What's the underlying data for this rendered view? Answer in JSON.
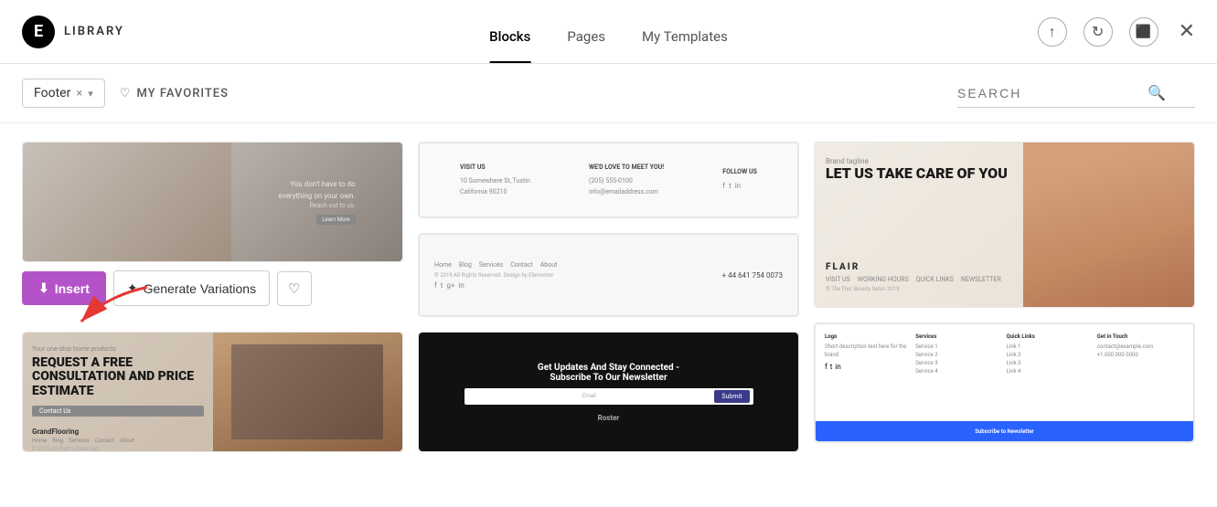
{
  "header": {
    "logo_letter": "E",
    "library_label": "LIBRARY",
    "tabs": [
      {
        "id": "blocks",
        "label": "Blocks",
        "active": true
      },
      {
        "id": "pages",
        "label": "Pages",
        "active": false
      },
      {
        "id": "my-templates",
        "label": "My Templates",
        "active": false
      }
    ],
    "icons": {
      "upload": "↑",
      "refresh": "↻",
      "save": "💾",
      "close": "✕"
    }
  },
  "toolbar": {
    "filter": {
      "label": "Footer",
      "clear_label": "×",
      "arrow_label": "▾"
    },
    "favorites_label": "MY FAVORITES",
    "search_placeholder": "SEARCH"
  },
  "cards": {
    "col1": [
      {
        "id": "c1r1",
        "type": "photo-footer"
      },
      {
        "id": "c1r2",
        "type": "flooring-footer"
      }
    ],
    "col2": [
      {
        "id": "c2r1",
        "type": "simple-3col"
      },
      {
        "id": "c2r2",
        "type": "nav-footer"
      },
      {
        "id": "c2r3",
        "type": "newsletter-dark"
      }
    ],
    "col3": [
      {
        "id": "c3r1",
        "type": "brand-beauty"
      },
      {
        "id": "c3r2",
        "type": "links-footer"
      }
    ]
  },
  "buttons": {
    "insert": "Insert",
    "generate_variations": "Generate Variations",
    "heart": "♡"
  }
}
